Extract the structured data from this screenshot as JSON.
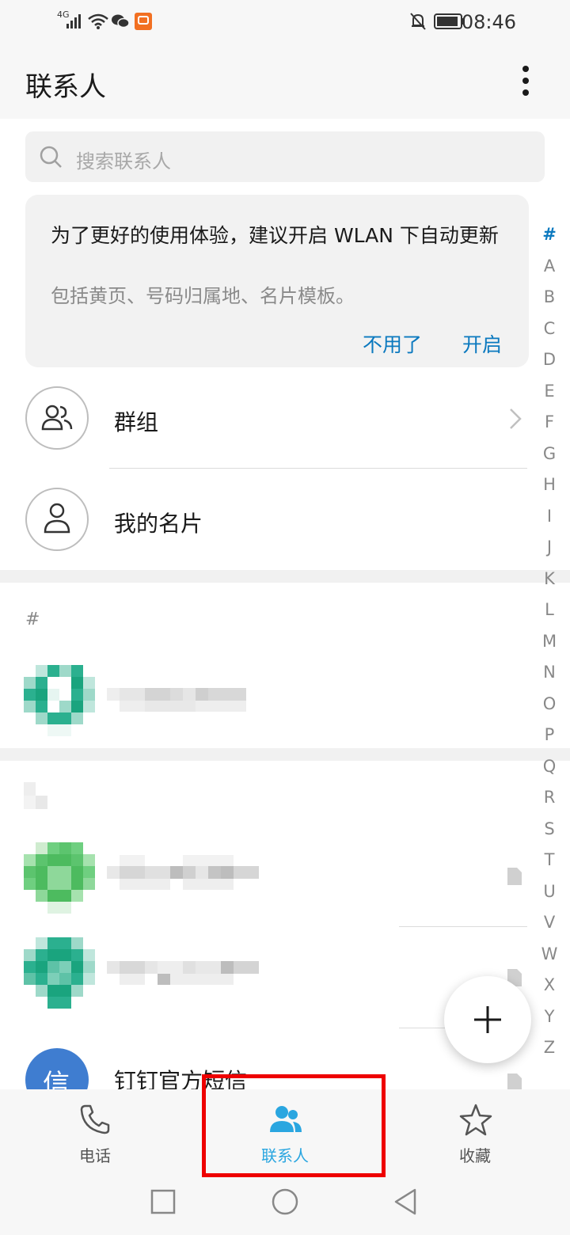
{
  "status_bar": {
    "network": "4G",
    "time": "08:46"
  },
  "app_bar": {
    "title": "联系人"
  },
  "search": {
    "placeholder": "搜索联系人"
  },
  "banner": {
    "title": "为了更好的使用体验，建议开启 WLAN 下自动更新",
    "subtitle": "包括黄页、号码归属地、名片模板。",
    "dismiss_label": "不用了",
    "enable_label": "开启"
  },
  "rows": {
    "groups_label": "群组",
    "my_card_label": "我的名片"
  },
  "sections": {
    "hash_header": "#"
  },
  "contacts": {
    "dingtalk_avatar_char": "信",
    "dingtalk_name": "钉钉官方短信"
  },
  "alpha_index": [
    "#",
    "A",
    "B",
    "C",
    "D",
    "E",
    "F",
    "G",
    "H",
    "I",
    "J",
    "K",
    "L",
    "M",
    "N",
    "O",
    "P",
    "Q",
    "R",
    "S",
    "T",
    "U",
    "V",
    "W",
    "X",
    "Y",
    "Z"
  ],
  "bottom_nav": {
    "phone_label": "电话",
    "contacts_label": "联系人",
    "favorites_label": "收藏"
  },
  "colors": {
    "accent": "#0b79bf",
    "active_tab": "#2aa6e0",
    "highlight": "#ee0000"
  }
}
